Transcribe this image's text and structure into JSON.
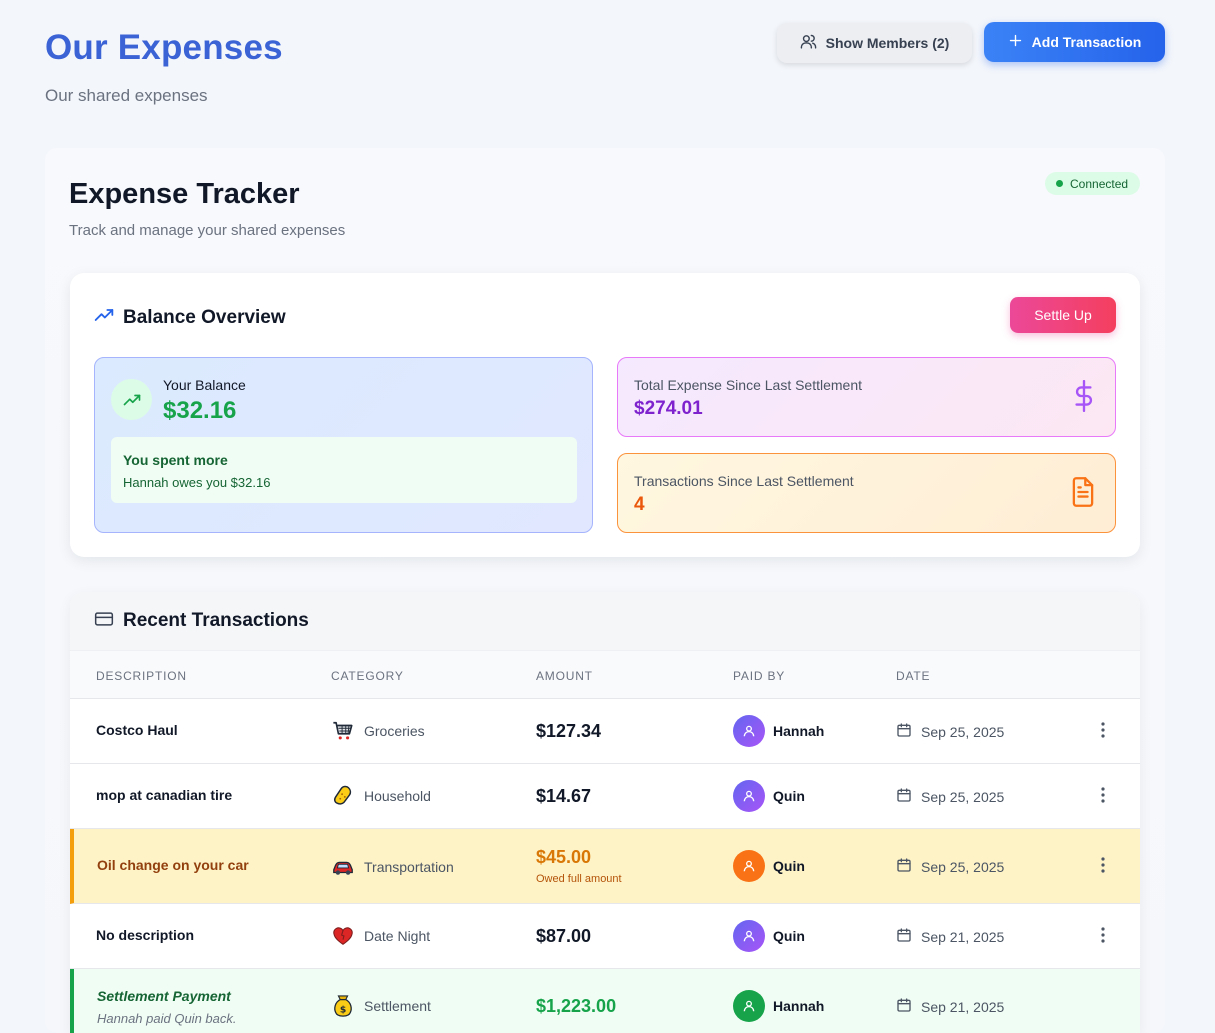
{
  "header": {
    "title": "Our Expenses",
    "subtitle": "Our shared expenses",
    "members_button": "Show Members (2)",
    "add_button": "Add Transaction"
  },
  "tracker": {
    "title": "Expense Tracker",
    "subtitle": "Track and manage your shared expenses",
    "status": "Connected"
  },
  "balance": {
    "title": "Balance Overview",
    "settle_button": "Settle Up",
    "your_balance_label": "Your Balance",
    "your_balance_amount": "$32.16",
    "note_title": "You spent more",
    "note_text": "Hannah owes you $32.16",
    "total_label": "Total Expense Since Last Settlement",
    "total_value": "$274.01",
    "count_label": "Transactions Since Last Settlement",
    "count_value": "4"
  },
  "transactions": {
    "title": "Recent Transactions",
    "columns": [
      "DESCRIPTION",
      "CATEGORY",
      "AMOUNT",
      "PAID BY",
      "DATE"
    ],
    "rows": [
      {
        "description": "Costco Haul",
        "category": "Groceries",
        "category_icon": "shopping-cart-icon",
        "amount": "$127.34",
        "payer": "Hannah",
        "date": "Sep 25, 2025"
      },
      {
        "description": "mop at canadian tire",
        "category": "Household",
        "category_icon": "sponge-icon",
        "amount": "$14.67",
        "payer": "Quin",
        "date": "Sep 25, 2025"
      },
      {
        "description": "Oil change on your car",
        "category": "Transportation",
        "category_icon": "car-icon",
        "amount": "$45.00",
        "amount_note": "Owed full amount",
        "payer": "Quin",
        "date": "Sep 25, 2025"
      },
      {
        "description": "No description",
        "category": "Date Night",
        "category_icon": "heart-icon",
        "amount": "$87.00",
        "payer": "Quin",
        "date": "Sep 21, 2025"
      },
      {
        "description": "Settlement Payment",
        "description_note": "Hannah paid Quin back.",
        "category": "Settlement",
        "category_icon": "money-bag-icon",
        "amount": "$1,223.00",
        "payer": "Hannah",
        "date": "Sep 21, 2025"
      }
    ]
  },
  "colors": {
    "title_blue": "#3b63d6",
    "primary": "#2563eb",
    "positive": "#16a34a",
    "settle_pink": "#ec4899",
    "total_purple": "#7e22ce",
    "count_orange": "#ea580c",
    "owed_highlight": "#fef3c7",
    "settlement_highlight": "#f0fdf4"
  }
}
